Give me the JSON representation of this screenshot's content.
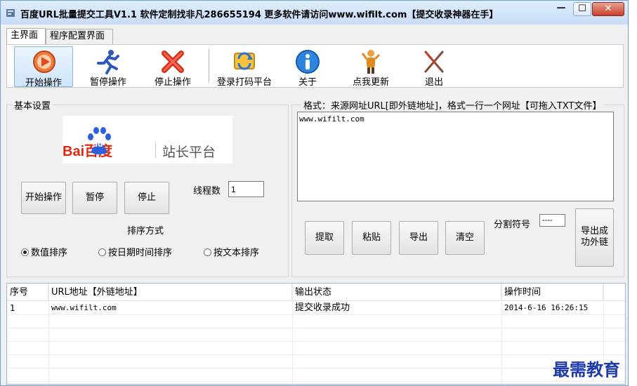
{
  "window": {
    "title": "百度URL批量提交工具V1.1 软件定制找非凡286655194 更多软件请访问www.wifilt.com【提交收录神器在手】",
    "controls": {
      "minimize": "—",
      "maximize": "☐",
      "close": "✕"
    }
  },
  "tabs": [
    {
      "label": "主界面",
      "active": true
    },
    {
      "label": "程序配置界面",
      "active": false
    }
  ],
  "toolbar": [
    {
      "label": "开始操作",
      "icon": "play-icon"
    },
    {
      "label": "暂停操作",
      "icon": "running-man-icon"
    },
    {
      "label": "停止操作",
      "icon": "red-x-icon"
    },
    {
      "label": "登录打码平台",
      "icon": "login-refresh-icon"
    },
    {
      "label": "关于",
      "icon": "info-icon"
    },
    {
      "label": "点我更新",
      "icon": "update-person-icon"
    },
    {
      "label": "退出",
      "icon": "exit-scissors-icon"
    }
  ],
  "basic": {
    "group_label": "基本设置",
    "logo": {
      "brand": "Bai百度",
      "paw_text": "du",
      "subtitle": "站长平台"
    },
    "start_button": "开始操作",
    "pause_button": "暂停",
    "stop_button": "停止",
    "threads_label": "线程数",
    "threads_value": "1",
    "sort_label": "排序方式",
    "sort_options": [
      {
        "label": "数值排序",
        "selected": true
      },
      {
        "label": "按日期时间排序",
        "selected": false
      },
      {
        "label": "按文本排序",
        "selected": false
      }
    ]
  },
  "source": {
    "format_label": "格式：来源网址URL[即外链地址]，格式一行一个网址【可拖入TXT文件】",
    "textarea_value": "www.wifilt.com",
    "buttons": {
      "extract": "提取",
      "paste": "粘贴",
      "export": "导出",
      "clear": "清空"
    },
    "separator_label": "分割符号",
    "separator_value": "----",
    "export_success_label": "导出成功外链"
  },
  "results": {
    "columns": [
      "序号",
      "URL地址【外链地址】",
      "输出状态",
      "操作时间"
    ],
    "rows": [
      {
        "no": "1",
        "url": "www.wifilt.com",
        "status": "提交收录成功",
        "time": "2014-6-16 16:26:15"
      }
    ]
  },
  "watermark": "最需教育",
  "colors": {
    "accent": "#6f9fd6",
    "close": "#c7402b",
    "watermark": "#1c3aa8"
  }
}
